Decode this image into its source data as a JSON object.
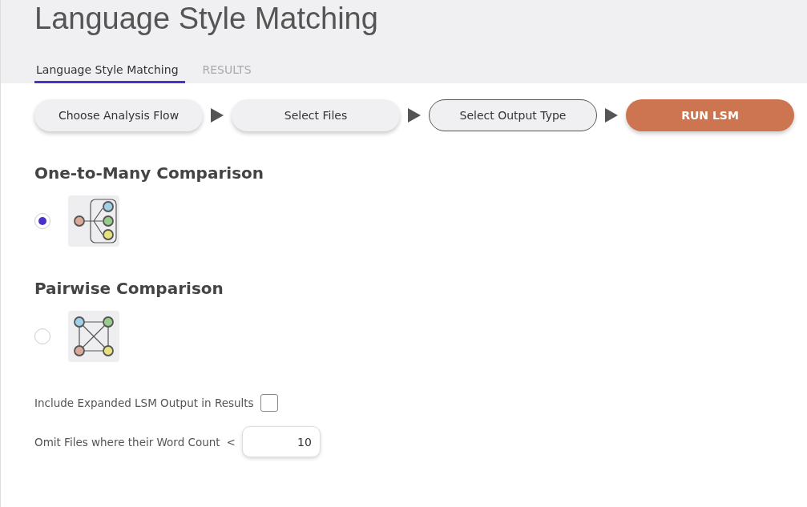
{
  "title": "Language Style Matching",
  "tabs": [
    {
      "label": "Language Style Matching",
      "selected": true
    },
    {
      "label": "RESULTS",
      "selected": false
    }
  ],
  "steps": [
    {
      "label": "Choose Analysis Flow",
      "kind": "step",
      "selected": false
    },
    {
      "label": "Select Files",
      "kind": "step",
      "selected": false
    },
    {
      "label": "Select Output Type",
      "kind": "step",
      "selected": true
    },
    {
      "label": "RUN LSM",
      "kind": "run",
      "selected": false
    }
  ],
  "options": [
    {
      "heading": "One-to-Many Comparison",
      "kind": "one-to-many",
      "selected": true
    },
    {
      "heading": "Pairwise Comparison",
      "kind": "pairwise",
      "selected": false
    }
  ],
  "expanded_output": {
    "label": "Include Expanded LSM Output in Results",
    "checked": false
  },
  "word_count": {
    "label": "Omit Files where their Word Count",
    "operator": "<",
    "value": "10"
  }
}
